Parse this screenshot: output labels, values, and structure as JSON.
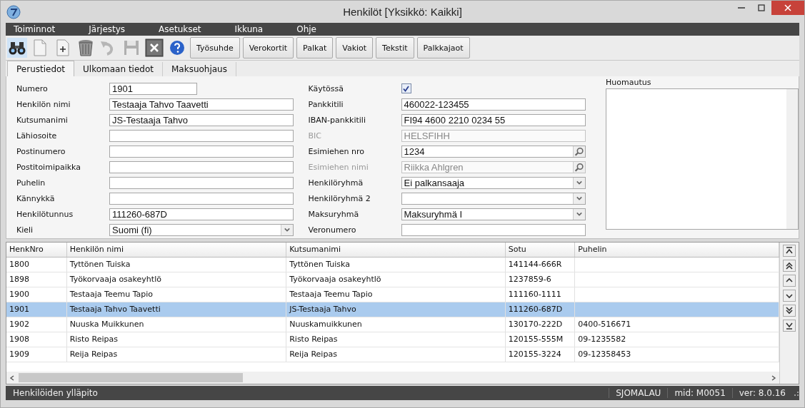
{
  "window": {
    "title": "Henkilöt [Yksikkö: Kaikki]"
  },
  "menu": [
    "Toiminnot",
    "Järjestys",
    "Asetukset",
    "Ikkuna",
    "Ohje"
  ],
  "toolbar": {
    "icons": [
      {
        "kind": "find",
        "disabled": false
      },
      {
        "kind": "new",
        "disabled": false
      },
      {
        "kind": "add",
        "disabled": false
      },
      {
        "kind": "delete",
        "disabled": false
      },
      {
        "kind": "undo",
        "disabled": true
      },
      {
        "kind": "save",
        "disabled": true
      },
      {
        "kind": "close",
        "disabled": false
      },
      {
        "kind": "help",
        "disabled": false
      }
    ],
    "buttons": [
      "Työsuhde",
      "Verokortit",
      "Palkat",
      "Vakiot",
      "Tekstit",
      "Palkkajaot"
    ]
  },
  "tabs": [
    {
      "label": "Perustiedot",
      "selected": true
    },
    {
      "label": "Ulkomaan tiedot",
      "selected": false
    },
    {
      "label": "Maksuohjaus",
      "selected": false
    }
  ],
  "form_left": [
    {
      "label": "Numero",
      "kind": "short",
      "value": "1901",
      "disabled": false
    },
    {
      "label": "Henkilön nimi",
      "kind": "text",
      "value": "Testaaja Tahvo Taavetti",
      "disabled": false
    },
    {
      "label": "Kutsumanimi",
      "kind": "text",
      "value": "JS-Testaaja Tahvo",
      "disabled": false
    },
    {
      "label": "Lähiosoite",
      "kind": "text",
      "disabled": false
    },
    {
      "label": "Postinumero",
      "kind": "text",
      "disabled": false
    },
    {
      "label": "Postitoimipaikka",
      "kind": "text",
      "disabled": false
    },
    {
      "label": "Puhelin",
      "kind": "text",
      "disabled": false
    },
    {
      "label": "Kännykkä",
      "kind": "text",
      "disabled": false
    },
    {
      "label": "Henkilötunnus",
      "kind": "text",
      "value": "111260-687D",
      "disabled": false
    },
    {
      "label": "Kieli",
      "kind": "select",
      "value": "Suomi (fi)",
      "disabled": false
    }
  ],
  "form_right": [
    {
      "label": "Käytössä",
      "kind": "checkbox",
      "checked": true,
      "disabled": false
    },
    {
      "label": "Pankkitili",
      "kind": "text",
      "value": "460022-123455",
      "disabled": false
    },
    {
      "label": "IBAN-pankkitili",
      "kind": "text",
      "value": "FI94 4600 2210 0234 55",
      "disabled": false
    },
    {
      "label": "BIC",
      "kind": "text",
      "value": "HELSFIHH",
      "disabled": true
    },
    {
      "label": "Esimiehen nro",
      "kind": "search",
      "value": "1234",
      "disabled": false
    },
    {
      "label": "Esimiehen nimi",
      "kind": "search",
      "value": "Riikka Ahlgren",
      "disabled": true
    },
    {
      "label": "Henkilöryhmä",
      "kind": "select",
      "value": "Ei palkansaaja",
      "disabled": false
    },
    {
      "label": "Henkilöryhmä 2",
      "kind": "select",
      "disabled": false
    },
    {
      "label": "Maksuryhmä",
      "kind": "select",
      "value": "Maksuryhmä I",
      "disabled": false
    },
    {
      "label": "Veronumero",
      "kind": "text",
      "disabled": false
    }
  ],
  "notes": {
    "label": "Huomautus"
  },
  "table": {
    "columns": [
      "HenkNro",
      "Henkilön nimi",
      "Kutsumanimi",
      "Sotu",
      "Puhelin"
    ],
    "rows": [
      {
        "cells": [
          "1800",
          "Tyttönen Tuiska",
          "Tyttönen Tuiska",
          "141144-666R",
          ""
        ],
        "selected": false
      },
      {
        "cells": [
          "1898",
          "Työkorvaaja osakeyhtlö",
          "Työkorvaaja osakeyhtlö",
          "1237859-6",
          ""
        ],
        "selected": false
      },
      {
        "cells": [
          "1900",
          "Testaaja Teemu Tapio",
          "Testaaja Teemu Tapio",
          "111160-1111",
          ""
        ],
        "selected": false
      },
      {
        "cells": [
          "1901",
          "Testaaja Tahvo Taavetti",
          "JS-Testaaja Tahvo",
          "111260-687D",
          ""
        ],
        "selected": true
      },
      {
        "cells": [
          "1902",
          "Nuuska Muikkunen",
          "Nuuskamuikkunen",
          "130170-222D",
          "0400-516671"
        ],
        "selected": false
      },
      {
        "cells": [
          "1908",
          "Risto Reipas",
          "Risto Reipas",
          "120155-555M",
          "09-1235582"
        ],
        "selected": false
      },
      {
        "cells": [
          "1909",
          "Reija Reipas",
          "Reija Reipas",
          "120155-3224",
          "09-12358453"
        ],
        "selected": false
      }
    ]
  },
  "status_bar": {
    "text": "Henkilöiden ylläpito",
    "user": "SJOMALAU",
    "mid": "mid: M0051",
    "version": "ver: 8.0.16"
  }
}
